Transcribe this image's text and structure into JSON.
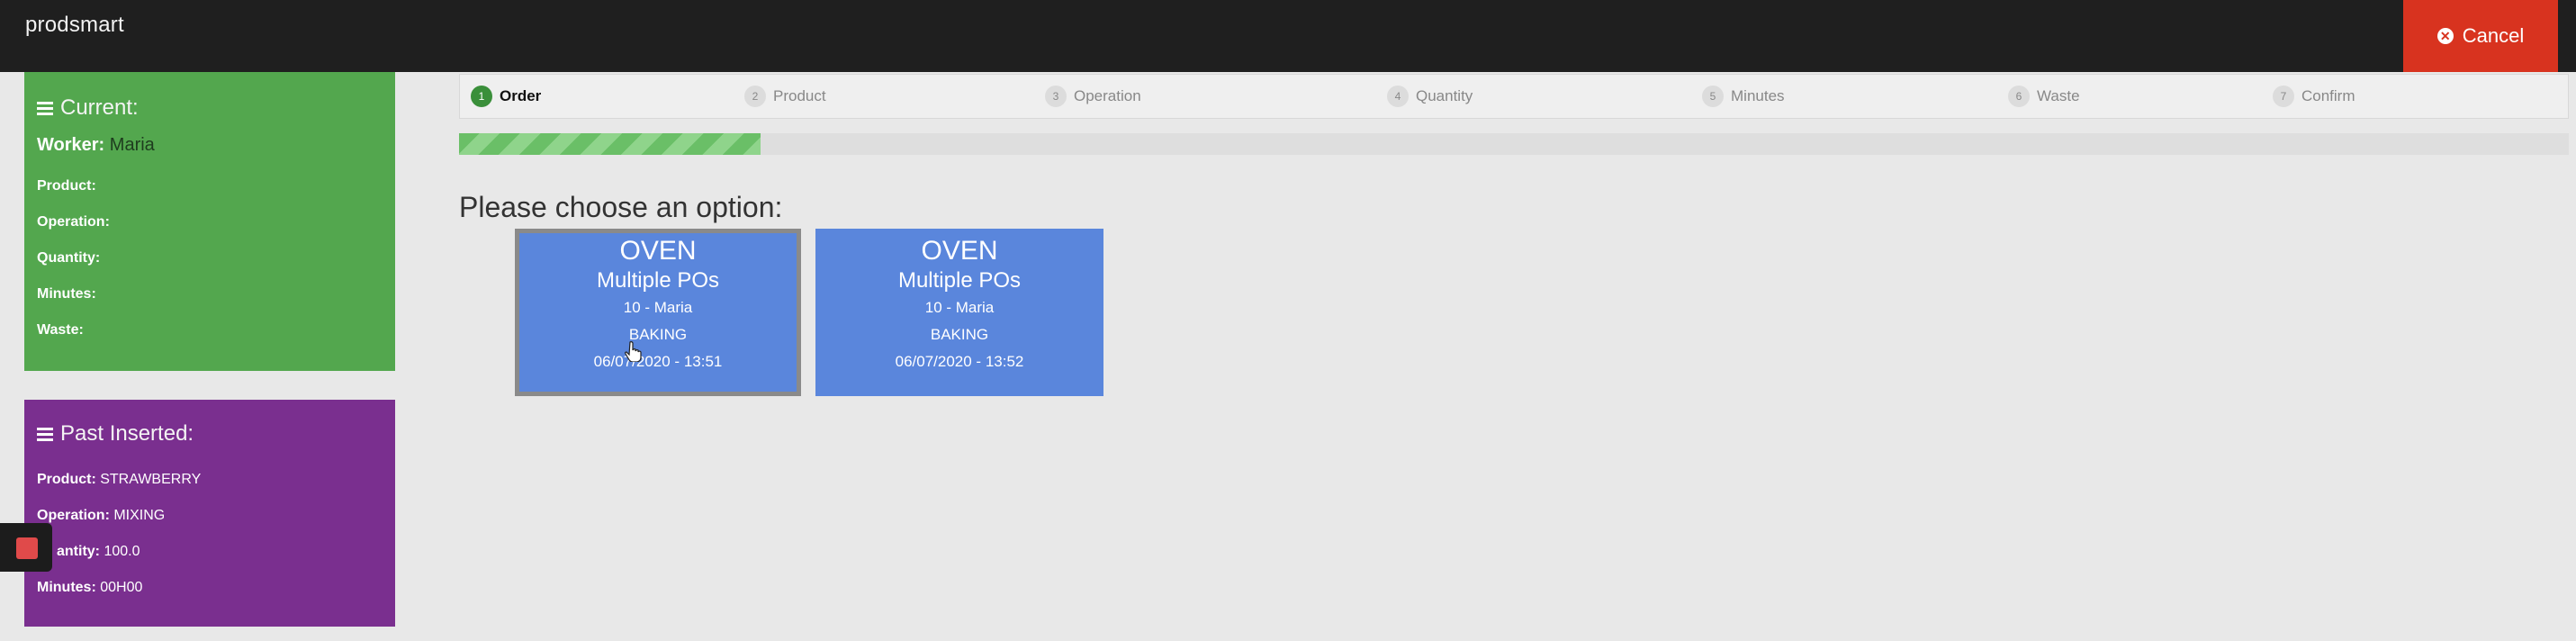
{
  "app": {
    "brand": "prodsmart"
  },
  "header": {
    "cancel_label": "Cancel"
  },
  "current": {
    "title": "Current:",
    "worker_label": "Worker:",
    "worker_value": "Maria",
    "fields": [
      "Product:",
      "Operation:",
      "Quantity:",
      "Minutes:",
      "Waste:"
    ]
  },
  "past": {
    "title": "Past Inserted:",
    "rows": [
      {
        "label": "Product:",
        "value": "STRAWBERRY"
      },
      {
        "label": "Operation:",
        "value": "MIXING"
      },
      {
        "label": "Quantity:",
        "value": "100.0"
      },
      {
        "label": "Minutes:",
        "value": "00H00"
      }
    ],
    "visible_labels": {
      "product": "Product:",
      "operation": "Operation:",
      "quantity": "antity:",
      "minutes": "Minutes:"
    }
  },
  "steps": [
    {
      "num": "1",
      "label": "Order",
      "active": true
    },
    {
      "num": "2",
      "label": "Product"
    },
    {
      "num": "3",
      "label": "Operation"
    },
    {
      "num": "4",
      "label": "Quantity"
    },
    {
      "num": "5",
      "label": "Minutes"
    },
    {
      "num": "6",
      "label": "Waste"
    },
    {
      "num": "7",
      "label": "Confirm"
    }
  ],
  "progress": {
    "fraction": 0.143
  },
  "prompt": "Please choose an option:",
  "options": [
    {
      "line1": "OVEN",
      "line2": "Multiple POs",
      "line3": "10 - Maria",
      "line4": "BAKING",
      "line5": "06/07/2020 - 13:51",
      "selected": true
    },
    {
      "line1": "OVEN",
      "line2": "Multiple POs",
      "line3": "10 - Maria",
      "line4": "BAKING",
      "line5": "06/07/2020 - 13:52",
      "selected": false
    }
  ],
  "colors": {
    "topbar": "#1f1f1f",
    "cancel": "#d8331f",
    "current_panel": "#53a74e",
    "past_panel": "#7a2f8f",
    "option_card": "#5a86dc",
    "active_step": "#3a8f3a"
  },
  "icons": {
    "menu": "menu-icon",
    "cancel": "close-circle-icon",
    "record": "stop-record-icon",
    "pointer": "hand-cursor-icon"
  }
}
